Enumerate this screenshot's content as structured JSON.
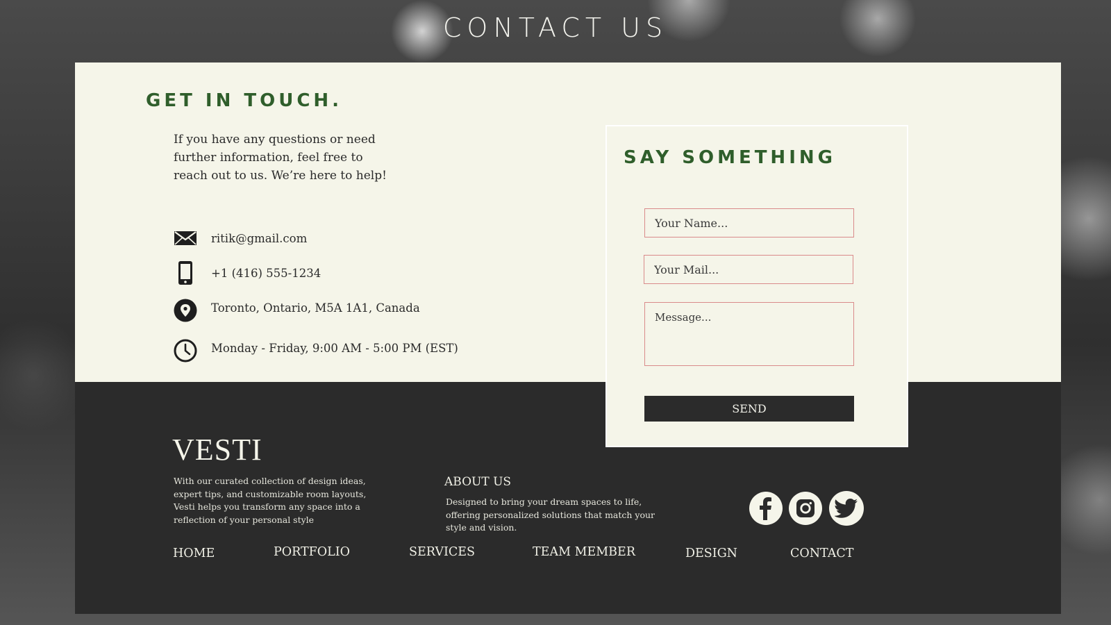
{
  "header": {
    "title": "CONTACT US"
  },
  "contact": {
    "heading": "GET IN TOUCH.",
    "intro": "If you have any questions or need further information, feel free to reach out to us. We’re here to help!",
    "email": {
      "icon": "envelope-icon",
      "text": "ritik@gmail.com"
    },
    "phone": {
      "icon": "phone-icon",
      "text": "+1 (416) 555-1234"
    },
    "address": {
      "icon": "location-pin-icon",
      "text": "Toronto, Ontario, M5A 1A1, Canada"
    },
    "hours": {
      "icon": "clock-icon",
      "text": "Monday - Friday, 9:00 AM - 5:00 PM (EST)"
    }
  },
  "form": {
    "heading": "SAY SOMETHING",
    "name_placeholder": "Your Name...",
    "mail_placeholder": "Your Mail...",
    "message_placeholder": "Message...",
    "send_label": "SEND"
  },
  "footer": {
    "brand": "VESTI",
    "brand_desc": "With our curated collection of design ideas, expert tips, and customizable room layouts, Vesti helps you transform any space into a reflection of your personal style",
    "about_title": "ABOUT US",
    "about_desc": "Designed to bring your dream spaces to life, offering personalized solutions that match your style and vision.",
    "social": [
      "facebook-icon",
      "instagram-icon",
      "twitter-icon"
    ],
    "nav": [
      "HOME",
      "PORTFOLIO",
      "SERVICES",
      "TEAM MEMBER",
      "DESIGN",
      "CONTACT"
    ]
  },
  "colors": {
    "cream": "#f5f5e9",
    "dark": "#2b2b2b",
    "green_heading": "#2f5e2b",
    "field_border": "#d98a8a"
  }
}
